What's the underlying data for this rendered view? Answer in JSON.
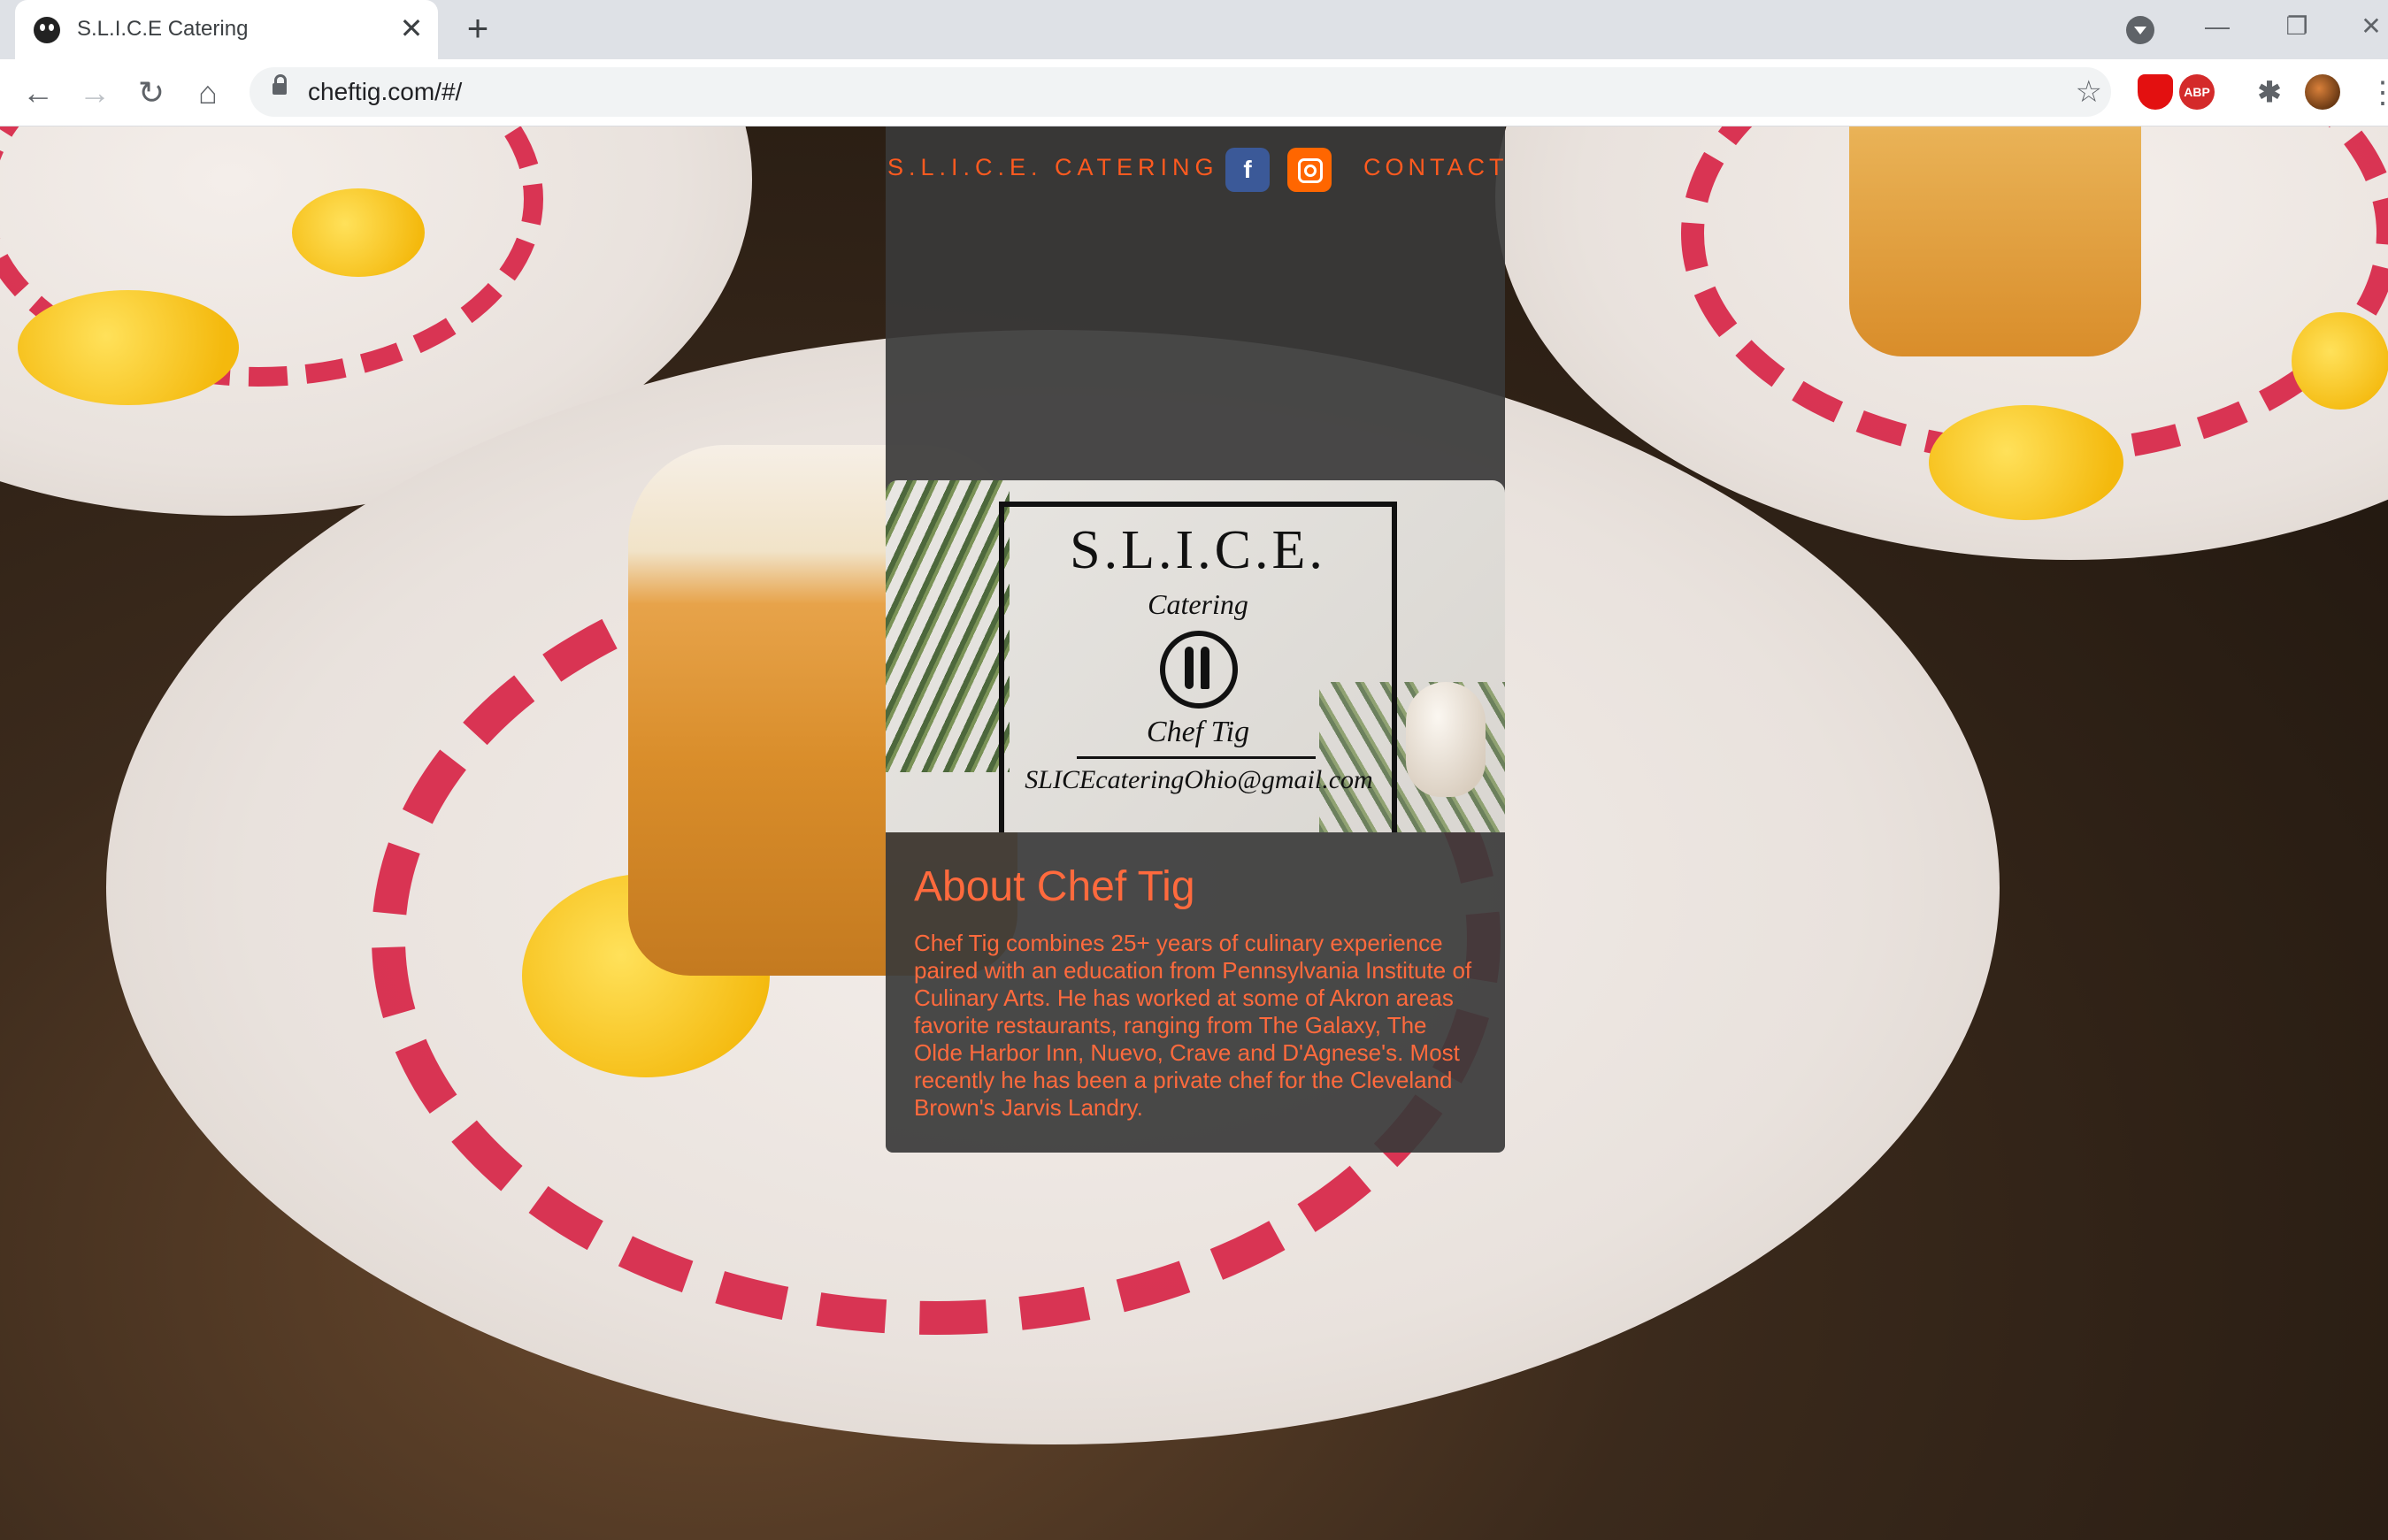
{
  "browser": {
    "tab_title": "S.L.I.C.E Catering",
    "tab_close": "✕",
    "new_tab": "+",
    "url": "cheftig.com/#/",
    "minimize": "—",
    "restore": "❐",
    "close": "✕"
  },
  "toolbar": {
    "back": "←",
    "forward": "→",
    "reload": "↻",
    "home": "⌂",
    "star": "☆",
    "ext_abp": "ABP",
    "ext_puzzle": "✱",
    "menu": "⋮"
  },
  "page": {
    "nav_brand": "S.L.I.C.E. CATERING",
    "facebook_glyph": "f",
    "nav_contact": "CONTACT",
    "logo": {
      "title": "S.L.I.C.E.",
      "subtitle": "Catering",
      "name": "Chef Tig",
      "email": "SLICEcateringOhio@gmail.com"
    },
    "about_title": "About Chef Tig",
    "about_body": "Chef Tig combines 25+ years of culinary experience paired with an education from Pennsylvania Institute of Culinary Arts. He has worked at some of Akron areas favorite restaurants, ranging from The Galaxy, The Olde Harbor Inn, Nuevo, Crave and D'Agnese's. Most recently he has been a private chef for the Cleveland Brown's Jarvis Landry."
  },
  "colors": {
    "accent": "#ff5a1f",
    "text_accent": "#ff6a3d",
    "panel": "#3a3a3a",
    "facebook": "#3b5998",
    "instagram": "#ff6600"
  },
  "icons": [
    "favicon-icon",
    "close-icon",
    "plus-icon",
    "back-icon",
    "forward-icon",
    "reload-icon",
    "home-icon",
    "lock-icon",
    "star-icon",
    "ublock-icon",
    "abp-icon",
    "puzzle-icon",
    "avatar-icon",
    "menu-icon",
    "facebook-icon",
    "instagram-icon"
  ]
}
